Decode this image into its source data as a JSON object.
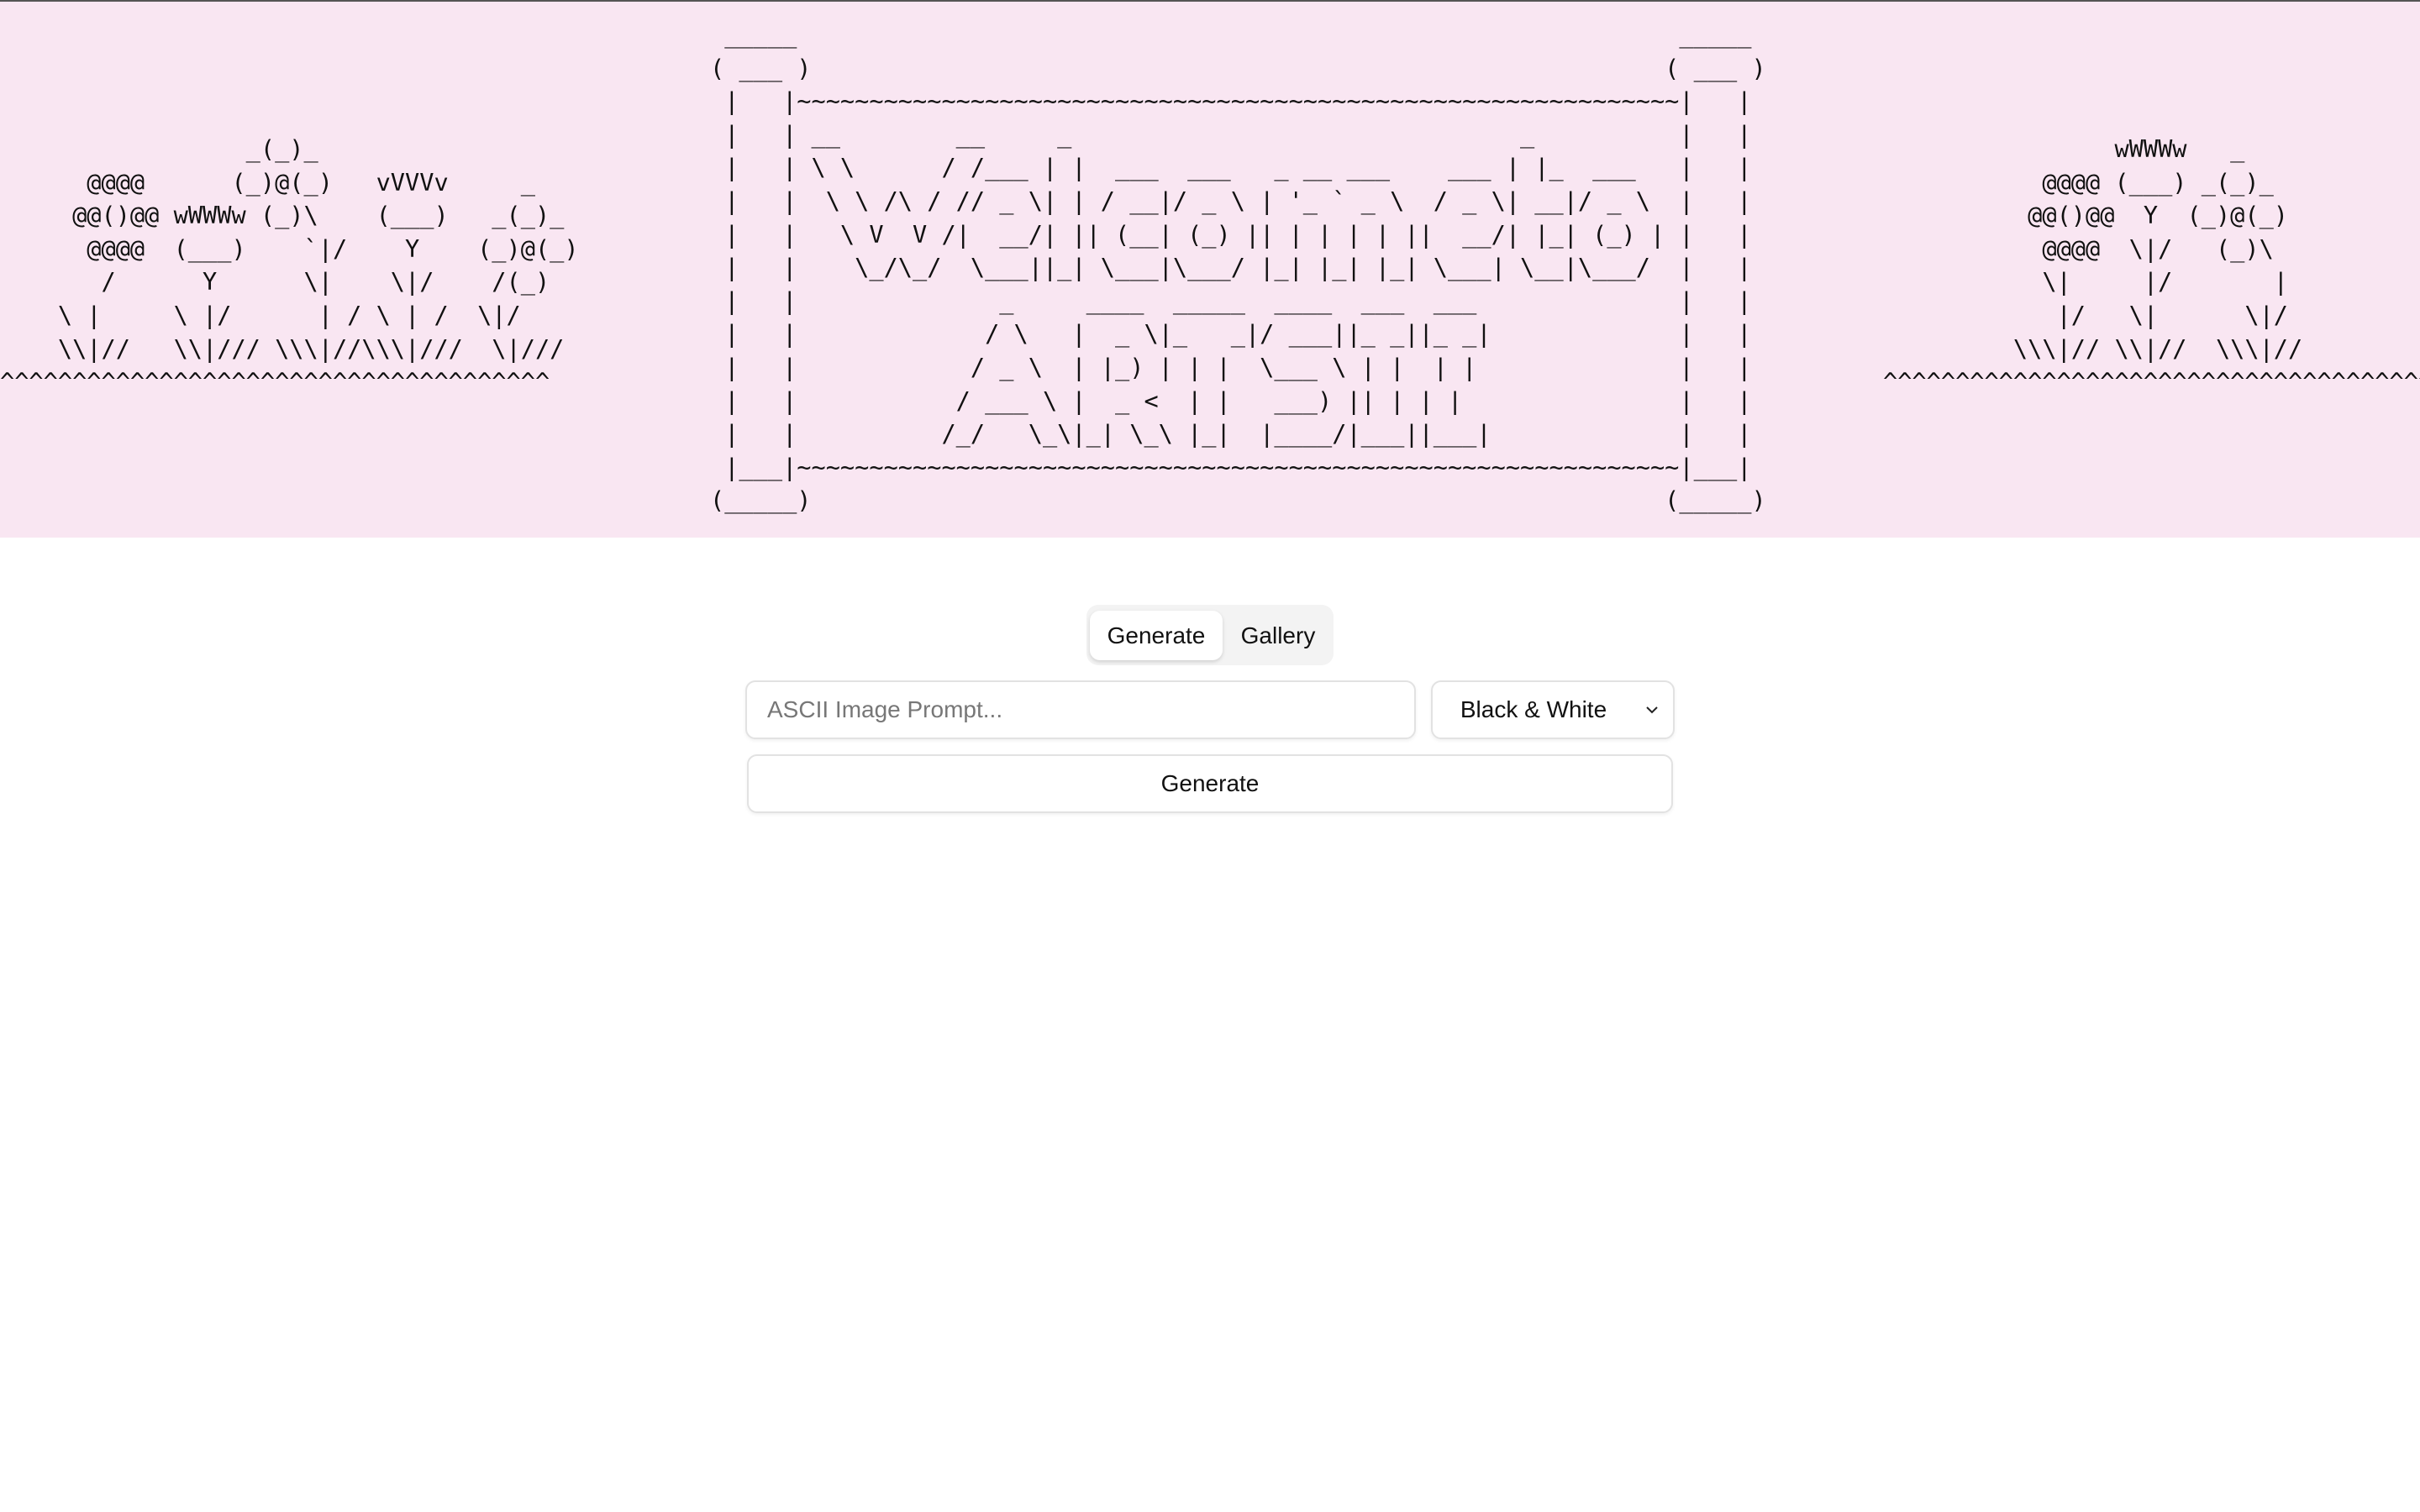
{
  "banner": {
    "background_color": "#f9e6f2",
    "left_flowers": "                 _(_)_\n      @@@@      (_)@(_)   vVVVv     _\n     @@()@@ wWWWw (_)\\    (___)   _(_)_\n      @@@@  (___)    `|/    Y    (_)@(_)\n       /      Y      \\|    \\|/    /(_)\n    \\ |     \\ |/      | / \\ | /  \\|/\n    \\\\|//   \\\\|/// \\\\\\|//\\\\\\|///  \\|///\n^^^^^^^^^^^^^^^^^^^^^^^^^^^^^^^^^^^^^^",
    "center_sign": " _____                                                             _____\n( ___ )                                                           ( ___ )\n |   |~~~~~~~~~~~~~~~~~~~~~~~~~~~~~~~~~~~~~~~~~~~~~~~~~~~~~~~~~~~~~|   |\n |   | __        __     _                               _          |   |\n |   | \\ \\      / /___ | |  ___  ___   _ __ ___    ___ | |_  ___   |   |\n |   |  \\ \\ /\\ / // _ \\| | / __|/ _ \\ | '_ ` _ \\  / _ \\| __|/ _ \\  |   |\n |   |   \\ V  V /|  __/| || (__| (_) || | | | | ||  __/| |_| (_) | |   |\n |   |    \\_/\\_/  \\___||_| \\___|\\___/ |_| |_| |_| \\___| \\__|\\___/  |   |\n |   |              _     ____  _____  ____  ___  ___              |   |\n |   |             / \\   |  _ \\|_   _|/ ___||_ _||_ _|             |   |\n |   |            / _ \\  | |_) | | |  \\___ \\ | |  | |              |   |\n |   |           / ___ \\ |  _ <  | |   ___) || | | |               |   |\n |   |          /_/   \\_\\|_| \\_\\ |_|  |____/|___||___|             |   |\n |___|~~~~~~~~~~~~~~~~~~~~~~~~~~~~~~~~~~~~~~~~~~~~~~~~~~~~~~~~~~~~~|___|\n(_____)                                                           (_____)",
    "right_flowers": "                wWWWw   _\n           @@@@ (___) _(_)_\n          @@()@@  Y  (_)@(_)\n           @@@@  \\|/   (_)\\\n           \\|     |/       |\n            |/   \\|      \\|/\n         \\\\\\|// \\\\|//  \\\\\\|//\n^^^^^^^^^^^^^^^^^^^^^^^^^^^^^^^^^^^^^^^^"
  },
  "tabs": [
    {
      "label": "Generate",
      "active": true
    },
    {
      "label": "Gallery",
      "active": false
    }
  ],
  "form": {
    "prompt_value": "",
    "prompt_placeholder": "ASCII Image Prompt...",
    "color_mode_selected": "Black & White",
    "color_mode_icon": "chevron-down-icon",
    "generate_label": "Generate"
  }
}
